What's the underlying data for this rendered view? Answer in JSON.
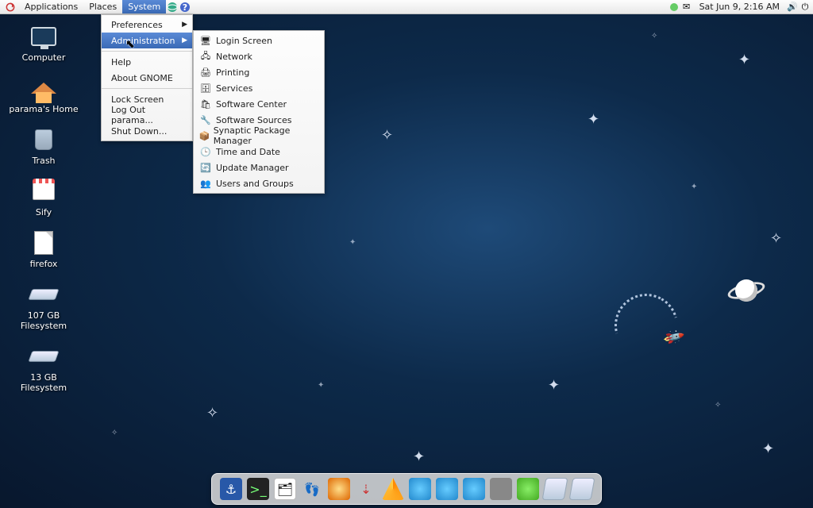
{
  "panel": {
    "menus": {
      "applications": "Applications",
      "places": "Places",
      "system": "System"
    },
    "clock": "Sat Jun  9,  2:16 AM"
  },
  "system_menu": {
    "preferences": "Preferences",
    "administration": "Administration",
    "help": "Help",
    "about": "About GNOME",
    "lock": "Lock Screen",
    "logout": "Log Out parama...",
    "shutdown": "Shut Down..."
  },
  "admin_submenu": {
    "items": [
      {
        "label": "Login Screen",
        "icon": "🖥"
      },
      {
        "label": "Network",
        "icon": "🖧"
      },
      {
        "label": "Printing",
        "icon": "🖨"
      },
      {
        "label": "Services",
        "icon": "🗄"
      },
      {
        "label": "Software Center",
        "icon": "🛍"
      },
      {
        "label": "Software Sources",
        "icon": "🔧"
      },
      {
        "label": "Synaptic Package Manager",
        "icon": "📦"
      },
      {
        "label": "Time and Date",
        "icon": "🕒"
      },
      {
        "label": "Update Manager",
        "icon": "🔄"
      },
      {
        "label": "Users and Groups",
        "icon": "👥"
      }
    ]
  },
  "desktop": {
    "icons": [
      {
        "label": "Computer",
        "kind": "monitor"
      },
      {
        "label": "parama's Home",
        "kind": "house"
      },
      {
        "label": "Trash",
        "kind": "trash"
      },
      {
        "label": "Sify",
        "kind": "shop"
      },
      {
        "label": "firefox",
        "kind": "doc"
      },
      {
        "label": "107 GB Filesystem",
        "kind": "drive"
      },
      {
        "label": "13 GB Filesystem",
        "kind": "drive"
      }
    ]
  }
}
